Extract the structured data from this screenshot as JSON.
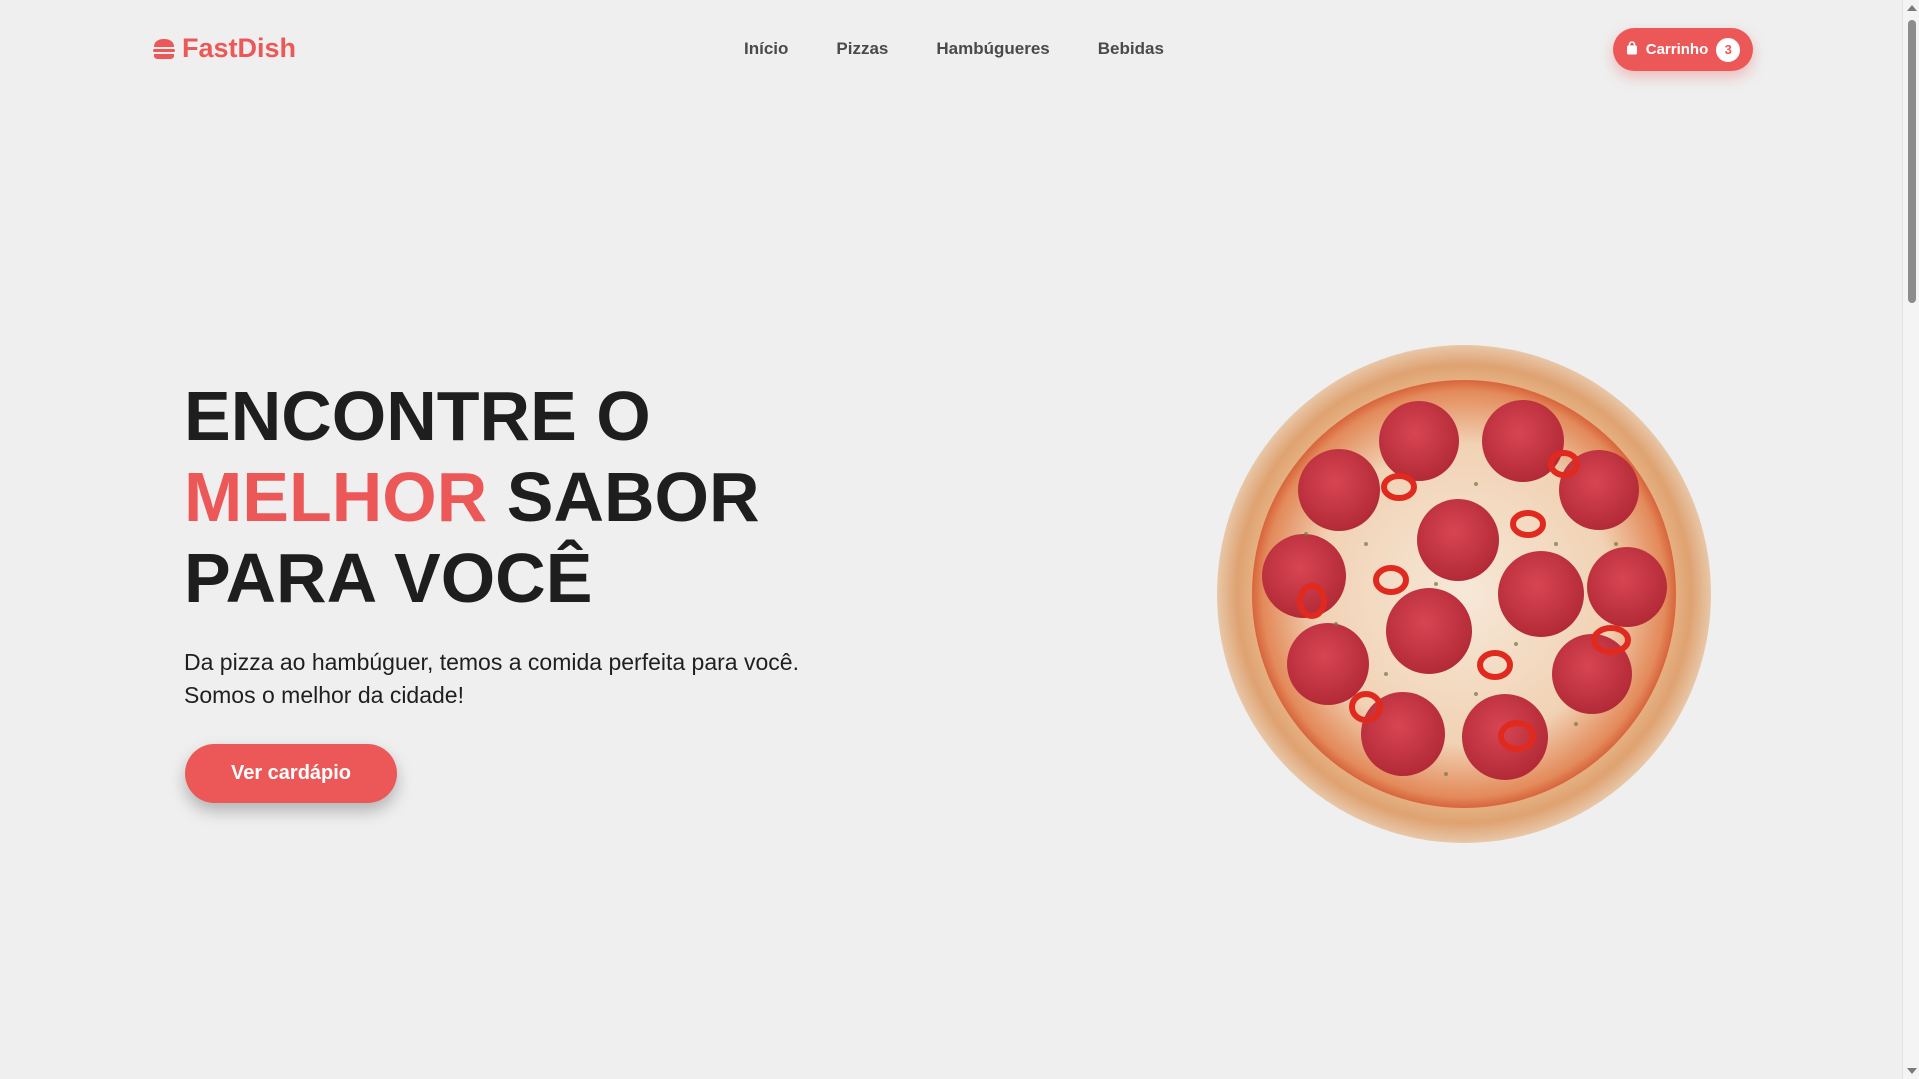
{
  "brand": {
    "name": "FastDish",
    "icon": "burger-icon",
    "color": "#ec5858"
  },
  "nav": {
    "items": [
      {
        "label": "Início"
      },
      {
        "label": "Pizzas"
      },
      {
        "label": "Hambúgueres"
      },
      {
        "label": "Bebidas"
      }
    ]
  },
  "cart": {
    "label": "Carrinho",
    "count": "3",
    "icon": "shopping-bag-icon"
  },
  "hero": {
    "title_line1": "ENCONTRE O",
    "title_accent": "MELHOR",
    "title_line2_rest": " SABOR",
    "title_line3": "PARA VOCÊ",
    "description": "Da pizza ao hambúguer, temos a comida perfeita para você. Somos o melhor da cidade!",
    "cta_label": "Ver cardápio",
    "image": "pepperoni-pizza"
  },
  "colors": {
    "accent": "#ec5858",
    "background": "#efefef",
    "text": "#1e1e1e"
  }
}
